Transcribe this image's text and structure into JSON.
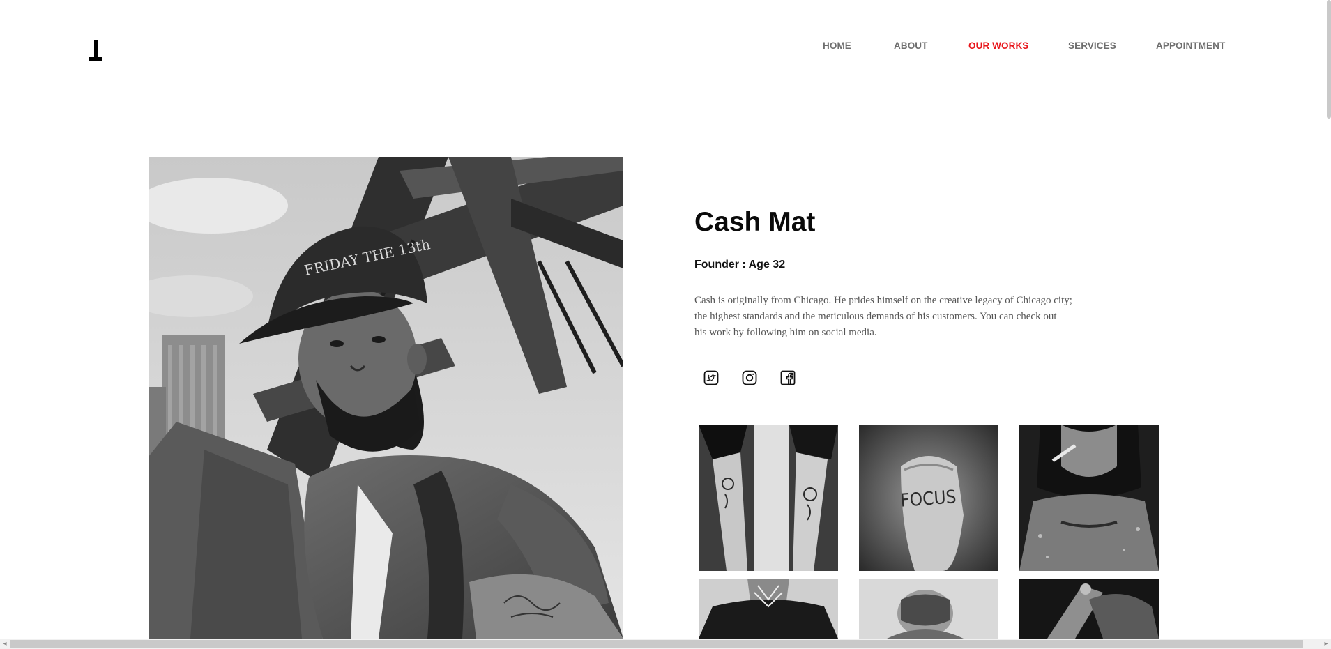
{
  "nav": {
    "home": "HOME",
    "about": "ABOUT",
    "our_works": "OUR WORKS",
    "services": "SERVICES",
    "appointment": "APPOINTMENT",
    "active_color": "#e8141a",
    "text_color": "#6e6e6e"
  },
  "profile": {
    "name": "Cash Mat",
    "role": "Founder : Age 32",
    "bio_lines": [
      "Cash is originally from Chicago. He prides himself on the creative legacy of Chicago city;",
      "the highest standards and the meticulous demands of his customers. You can check out",
      "his work by following him on social media."
    ]
  },
  "social": {
    "icons": [
      "twitter-icon",
      "instagram-icon",
      "facebook-icon"
    ]
  },
  "gallery": {
    "items": [
      {
        "subject": "legs with floral tattoos"
      },
      {
        "subject": "fist with FOCUS tattoo",
        "caption": "FOCUS"
      },
      {
        "subject": "woman smoking with chest tattoo"
      },
      {
        "subject": "neck geometric tattoo"
      },
      {
        "subject": "person covering face"
      },
      {
        "subject": "tattoo machine at work"
      }
    ]
  },
  "hero": {
    "cap_text": "FRIDAY THE 13th"
  }
}
